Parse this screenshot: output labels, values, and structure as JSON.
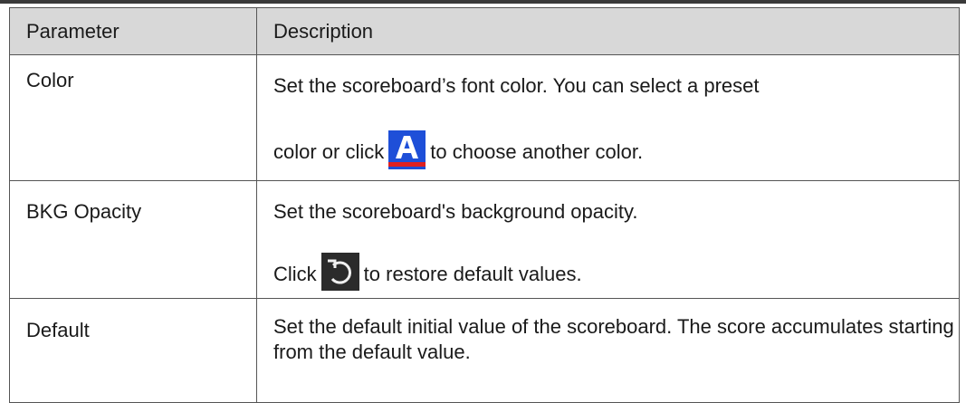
{
  "table": {
    "headers": [
      "Parameter",
      "Description"
    ],
    "rows": [
      {
        "parameter": "Color",
        "description_line1": "Set the scoreboard’s font color. You can select a preset",
        "description_line2_before_icon": "color or click",
        "icon": "font-color-icon",
        "description_line2_after_icon": "to choose another color."
      },
      {
        "parameter": "BKG Opacity",
        "description_line1": "Set the scoreboard's background opacity.",
        "description_line2_before_icon": "Click",
        "icon": "restore-default-icon",
        "description_line2_after_icon": "to restore default values."
      },
      {
        "parameter": "Default",
        "description": "Set the default initial value of the scoreboard. The score accumulates starting from the default value."
      }
    ]
  },
  "colors": {
    "header_background": "#d8d8d8",
    "border": "#555555",
    "font_color_icon_background": "#1e4fd8",
    "font_color_icon_underline": "#e02020",
    "restore_icon_background": "#2b2b2b"
  }
}
